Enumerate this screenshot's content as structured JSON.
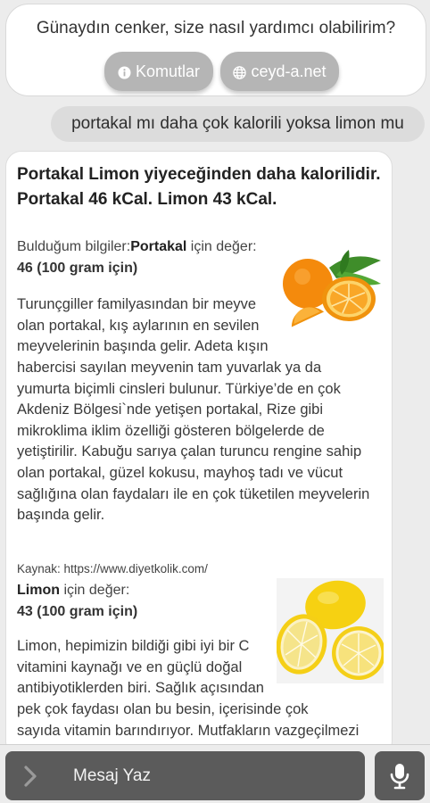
{
  "welcome": {
    "greeting": "Günaydın cenker, size nasıl yardımcı olabilirim?",
    "chips": [
      {
        "label": "Komutlar",
        "icon": "info-icon"
      },
      {
        "label": "ceyd-a.net",
        "icon": "globe-icon"
      }
    ]
  },
  "user_message": "portakal mı daha çok kalorili yoksa limon mu",
  "answer": {
    "headline_line1": "Portakal Limon yiyeceğinden daha kalorilidir.",
    "headline_line2": "Portakal 46 kCal. Limon 43 kCal.",
    "orange": {
      "prefix": "Bulduğum bilgiler:",
      "name": "Portakal",
      "suffix": " için değer:",
      "value": "46 (100 gram için)",
      "lines": [
        "Turunçgiller familyasından bir meyve",
        "olan portakal, kış aylarının en sevilen",
        "meyvelerinin başında gelir. Adeta kışın",
        "habercisi sayılan meyvenin tam yuvarlak ya da",
        "yumurta biçimli cinsleri bulunur. Türkiye’de en çok",
        "Akdeniz Bölgesi`nde yetişen portakal, Rize gibi",
        "mikroklima iklim özelliği gösteren bölgelerde de",
        "yetiştirilir. Kabuğu sarıya çalan turuncu rengine sahip",
        "olan portakal, güzel kokusu, mayhoş tadı ve vücut",
        "sağlığına olan faydaları ile en çok tüketilen meyvelerin",
        "başında gelir."
      ]
    },
    "source": "Kaynak: https://www.diyetkolik.com/",
    "lemon": {
      "name": "Limon",
      "suffix": " için değer:",
      "value": "43 (100 gram için)",
      "lines": [
        "Limon, hepimizin bildiği gibi iyi bir C",
        "vitamini kaynağı ve en güçlü doğal",
        "antibiyotiklerden biri. Sağlık açısından",
        "pek çok faydası olan bu besin, içerisinde çok",
        "sayıda vitamin barındırıyor. Mutfakların vazgeçilmezi"
      ]
    }
  },
  "input": {
    "label": "Mesaj Yaz",
    "icons": [
      "chevron-right-icon",
      "microphone-icon"
    ]
  },
  "colors": {
    "background": "#ececec",
    "chip": "#b5b5b5",
    "user_bubble": "#dcdcdc",
    "input_bar": "#5b5b5b"
  }
}
